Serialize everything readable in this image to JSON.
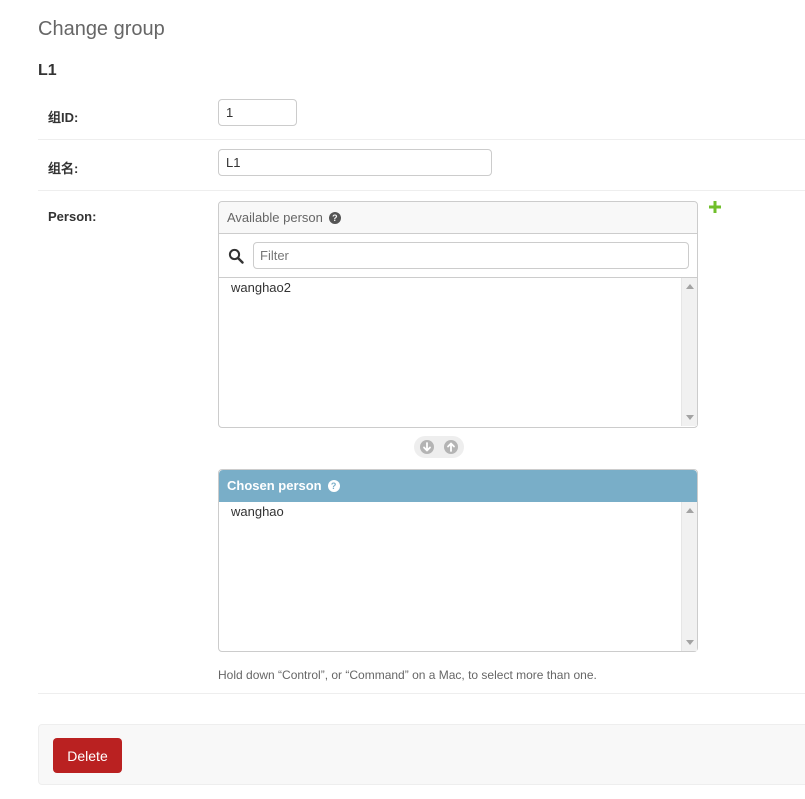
{
  "page": {
    "title": "Change group",
    "object_name": "L1"
  },
  "fields": {
    "group_id": {
      "label": "组ID:",
      "value": "1"
    },
    "group_name": {
      "label": "组名:",
      "value": "L1"
    },
    "person": {
      "label": "Person:"
    }
  },
  "selector": {
    "available": {
      "title": "Available person",
      "help_icon": "question-circle-icon",
      "filter_placeholder": "Filter",
      "items": [
        "wanghao2"
      ]
    },
    "chosen": {
      "title": "Chosen person",
      "help_icon": "question-circle-icon",
      "items": [
        "wanghao"
      ]
    },
    "chooser_icons": {
      "add": "arrow-down-circle-icon",
      "remove": "arrow-up-circle-icon"
    },
    "add_related_icon": "plus-icon",
    "help_text": "Hold down “Control”, or “Command” on a Mac, to select more than one."
  },
  "actions": {
    "delete_label": "Delete"
  },
  "colors": {
    "chosen_header": "#79aec8",
    "delete_button": "#ba2121",
    "add_icon": "#70bf2b",
    "chooser_icon": "#b4b4b4"
  }
}
